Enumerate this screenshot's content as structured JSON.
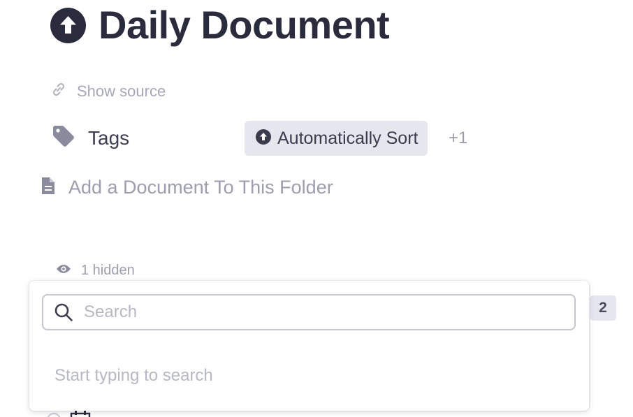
{
  "document": {
    "title": "Daily Document",
    "show_source_label": "Show source",
    "tags_label": "Tags",
    "tag_chip_label": "Automatically Sort",
    "tag_more": "+1",
    "add_document_label": "Add a Document To This Folder",
    "hidden_label": "1 hidden",
    "count_badge": "2"
  },
  "search_popover": {
    "placeholder": "Search",
    "value": "",
    "hint": "Start typing to search"
  },
  "icons": {
    "title": "arrow-up-circle-icon",
    "source": "link-icon",
    "tags": "tag-icon",
    "chip": "arrow-up-circle-icon",
    "add_document": "document-icon",
    "hidden": "eye-icon",
    "search": "search-icon"
  },
  "colors": {
    "title_text": "#2a2b3d",
    "muted_text": "#9c9eae",
    "chip_background": "#e5e6ee",
    "search_border": "#c4c5d2"
  }
}
